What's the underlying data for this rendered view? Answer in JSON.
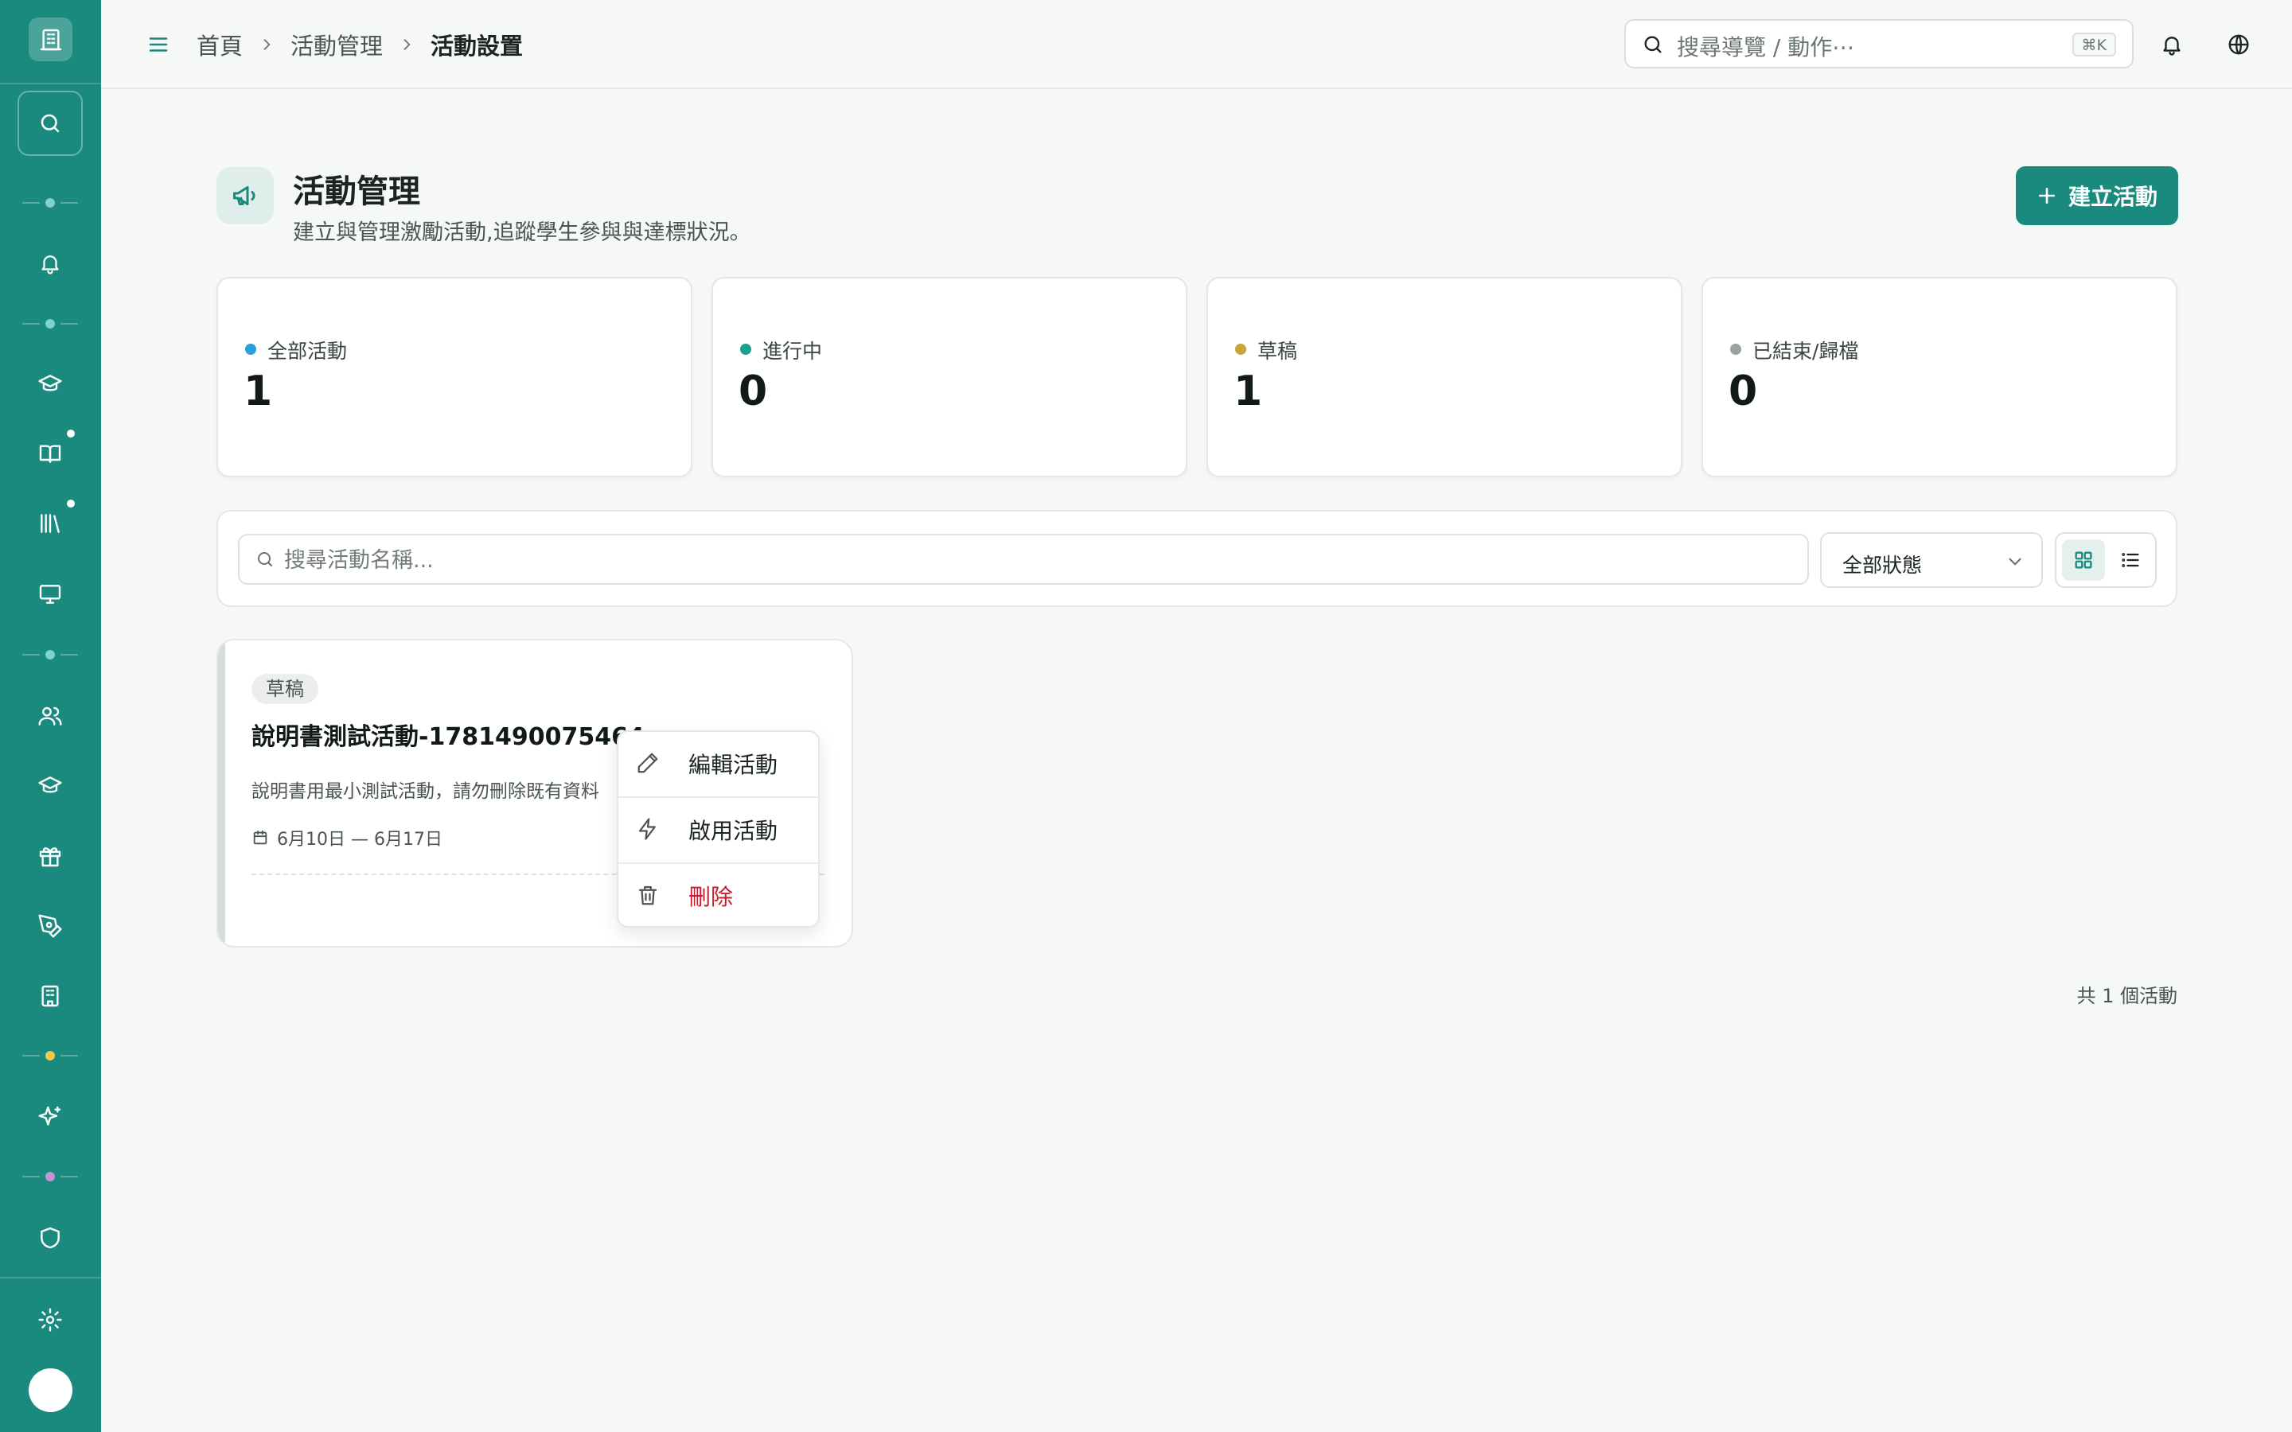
{
  "header": {
    "breadcrumbs": [
      "首頁",
      "活動管理",
      "活動設置"
    ],
    "search_placeholder": "搜尋導覽 / 動作⋯",
    "search_shortcut": "⌘K"
  },
  "sidebar": {
    "items": [
      {
        "icon": "search-icon"
      },
      {
        "icon": "bell-icon"
      },
      {
        "icon": "graduation-cap-icon"
      },
      {
        "icon": "book-icon",
        "badge": true
      },
      {
        "icon": "library-icon",
        "badge": true
      },
      {
        "icon": "monitor-icon"
      },
      {
        "icon": "users-icon"
      },
      {
        "icon": "graduation-cap-icon"
      },
      {
        "icon": "gift-icon"
      },
      {
        "icon": "pen-tool-icon"
      },
      {
        "icon": "building-icon"
      },
      {
        "icon": "sparkles-icon"
      },
      {
        "icon": "shield-icon"
      },
      {
        "icon": "settings-icon"
      }
    ],
    "separator_dot_colors": [
      "#7fd3cb",
      "#7fd3cb",
      "#7fd3cb",
      "#f2c94c",
      "#c693d8"
    ]
  },
  "page": {
    "title": "活動管理",
    "subtitle": "建立與管理激勵活動,追蹤學生參與與達標狀況。",
    "create_button": "建立活動"
  },
  "stats": [
    {
      "label": "全部活動",
      "value": "1",
      "color": "#2b9fd9"
    },
    {
      "label": "進行中",
      "value": "0",
      "color": "#1aa08f"
    },
    {
      "label": "草稿",
      "value": "1",
      "color": "#c9a43a"
    },
    {
      "label": "已結束/歸檔",
      "value": "0",
      "color": "#9aa19f"
    }
  ],
  "filters": {
    "search_placeholder": "搜尋活動名稱...",
    "search_value": "",
    "status_selected": "全部狀態",
    "view_mode": "grid"
  },
  "activities": [
    {
      "status": "草稿",
      "title": "說明書測試活動-1781490075464",
      "description": "說明書用最小測試活動，請勿刪除既有資料",
      "date_range": "6月10日 — 6月17日"
    }
  ],
  "context_menu": {
    "items": [
      {
        "label": "編輯活動",
        "icon": "pencil-icon"
      },
      {
        "label": "啟用活動",
        "icon": "zap-icon"
      },
      {
        "label": "刪除",
        "icon": "trash-icon",
        "danger": true
      }
    ]
  },
  "footer": {
    "total": "共 1 個活動"
  },
  "colors": {
    "primary": "#1a8a7e",
    "danger": "#c91b2b"
  }
}
